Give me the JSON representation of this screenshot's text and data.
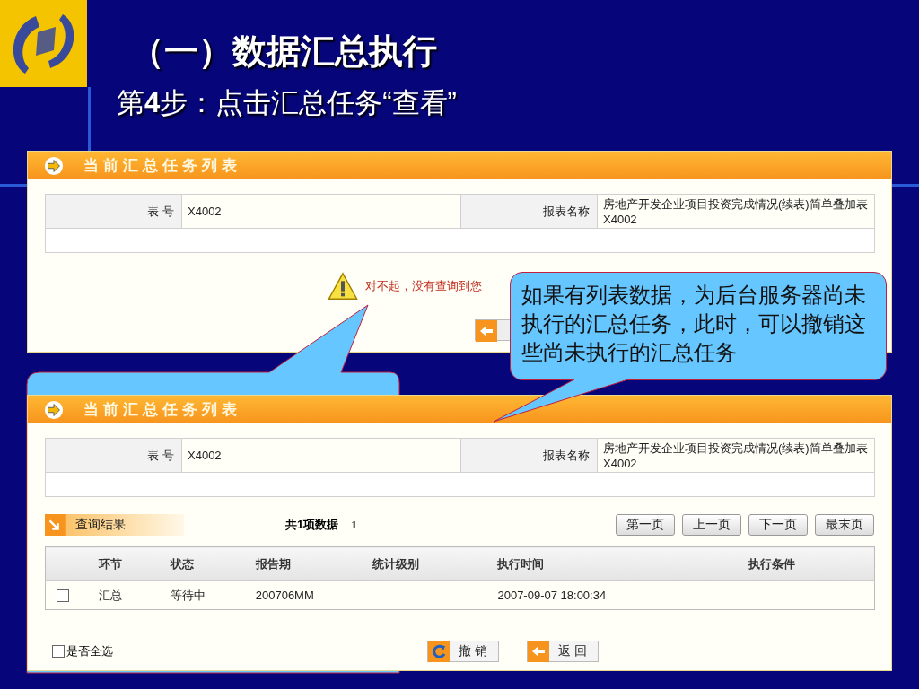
{
  "slide": {
    "title": "（一）数据汇总执行",
    "subtitle": "第**4**步：点击汇总任务“查看”"
  },
  "panels": [
    {
      "kind": "empty",
      "title": "当前汇总任务列表",
      "info": [
        {
          "label": "表 号",
          "value": "X4002"
        },
        {
          "label": "报表名称",
          "value": "房地产开发企业项目投资完成情况(续表)简单叠加表X4002"
        }
      ],
      "message": "对不起，没有查询到您"
    },
    {
      "kind": "results",
      "title": "当前汇总任务列表",
      "info": [
        {
          "label": "表 号",
          "value": "X4002"
        },
        {
          "label": "报表名称",
          "value": "房地产开发企业项目投资完成情况(续表)简单叠加表X4002"
        }
      ],
      "results": {
        "title": "查询结果",
        "count": "共1项数据",
        "page": "1",
        "pager": [
          "第一页",
          "上一页",
          "下一页",
          "最末页"
        ],
        "columns": [
          "环节",
          "状态",
          "报告期",
          "统计级别",
          "执行时间",
          "执行条件"
        ],
        "rows": [
          {
            "checked": false,
            "cells": [
              "汇总",
              "等待中",
              "200706MM",
              null,
              "2007-09-07 18:00:34",
              null
            ]
          }
        ],
        "select_all": {
          "label": "是否全选",
          "checked": false
        },
        "buttons": [
          {
            "kind": "revoke",
            "label": "撤 销"
          },
          {
            "kind": "back",
            "label": "返 回"
          }
        ]
      }
    }
  ],
  "callouts": [
    {
      "text": "如果有列表数据，为后台服务器尚未执行的汇总任务，此时，可以撤销这些尚未执行的汇总任务"
    }
  ]
}
